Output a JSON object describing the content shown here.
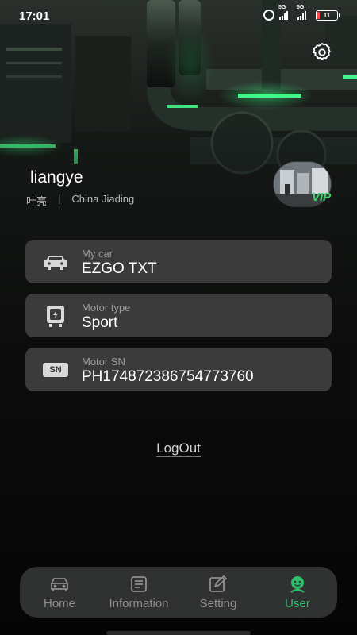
{
  "status_bar": {
    "time": "17:01",
    "signal_1_label": "5G",
    "signal_2_label": "5G",
    "battery_text": "11",
    "battery_level": 0.11,
    "battery_color": "#ff4a4a"
  },
  "profile": {
    "username": "liangye",
    "chinese_name": "叶亮",
    "separator": "|",
    "location": "China Jiading",
    "vip_badge": "VIP"
  },
  "cards": [
    {
      "label": "My car",
      "value": "EZGO TXT",
      "icon": "car-icon"
    },
    {
      "label": "Motor type",
      "value": "Sport",
      "icon": "motor-icon"
    },
    {
      "label": "Motor SN",
      "value": "PH174872386754773760",
      "icon": "sn-icon",
      "icon_text": "SN"
    }
  ],
  "logout_label": "LogOut",
  "nav": {
    "items": [
      {
        "label": "Home",
        "icon": "car-outline-icon",
        "active": false
      },
      {
        "label": "Information",
        "icon": "document-icon",
        "active": false
      },
      {
        "label": "Setting",
        "icon": "edit-icon",
        "active": false
      },
      {
        "label": "User",
        "icon": "user-icon",
        "active": true
      }
    ],
    "active_color": "#2fbf6c",
    "inactive_color": "#8e8e8e"
  },
  "accent_green": "#3fd46a"
}
